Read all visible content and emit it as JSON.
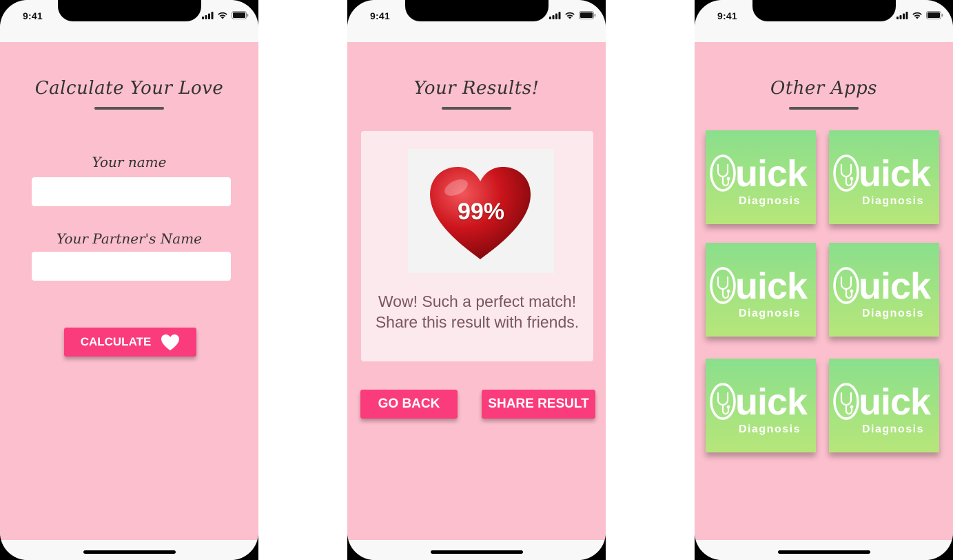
{
  "status_bar": {
    "time": "9:41"
  },
  "screens": {
    "calculate": {
      "title": "Calculate Your Love",
      "name_label": "Your name",
      "name_value": "",
      "partner_label": "Your Partner's Name",
      "partner_value": "",
      "calculate_button": "CALCULATE"
    },
    "results": {
      "title": "Your Results!",
      "percentage": "99%",
      "message_line1": "Wow! Such a perfect match!",
      "message_line2": "Share this result with friends.",
      "back_button": "GO BACK",
      "share_button": "SHARE RESULT"
    },
    "other_apps": {
      "title": "Other Apps",
      "apps": [
        {
          "name": "uick",
          "subtitle": "Diagnosis",
          "icon": "stethoscope-q-logo"
        },
        {
          "name": "uick",
          "subtitle": "Diagnosis",
          "icon": "stethoscope-q-logo"
        },
        {
          "name": "uick",
          "subtitle": "Diagnosis",
          "icon": "stethoscope-q-logo"
        },
        {
          "name": "uick",
          "subtitle": "Diagnosis",
          "icon": "stethoscope-q-logo"
        },
        {
          "name": "uick",
          "subtitle": "Diagnosis",
          "icon": "stethoscope-q-logo"
        },
        {
          "name": "uick",
          "subtitle": "Diagnosis",
          "icon": "stethoscope-q-logo"
        }
      ]
    }
  },
  "colors": {
    "background_pink": "#fbbfcd",
    "button_pink": "#fa3c7c",
    "card_pink": "#fce9ee",
    "tile_green_top": "#8adf8c",
    "tile_green_bottom": "#b7e67a",
    "heart_red": "#c8101a"
  }
}
